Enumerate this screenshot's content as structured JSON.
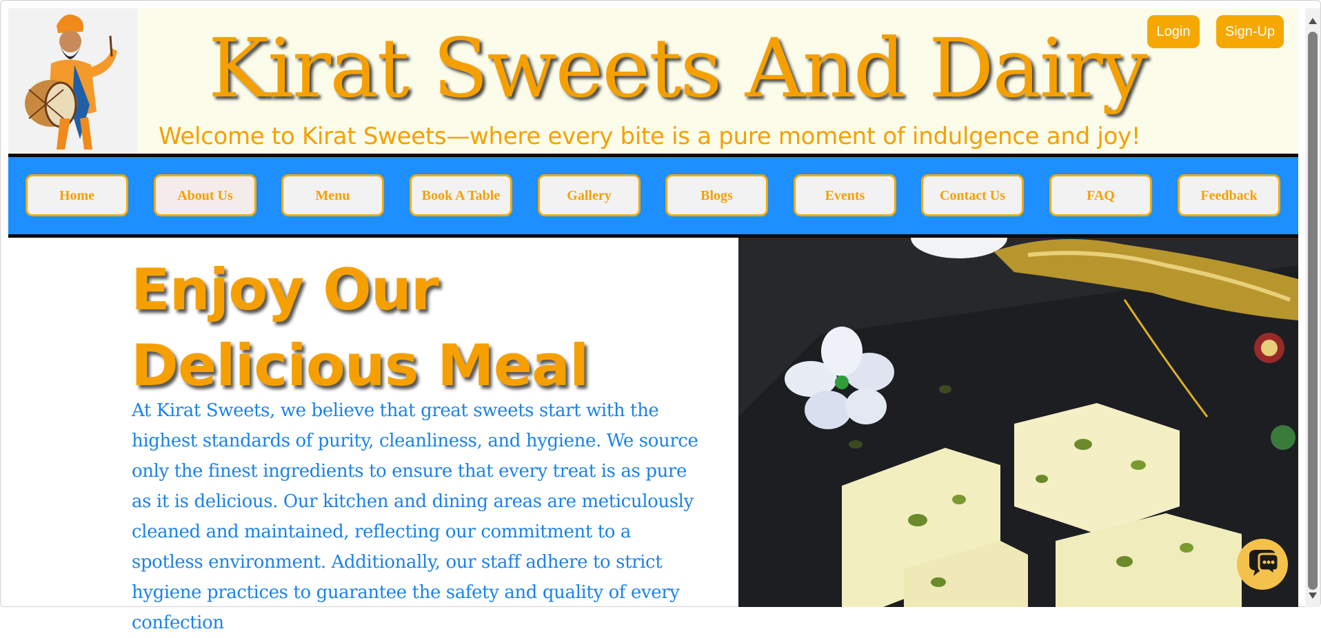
{
  "header": {
    "title": "Kirat Sweets And Dairy",
    "tagline": "Welcome to Kirat Sweets—where every bite is a pure moment of indulgence and joy!",
    "login_label": "Login",
    "signup_label": "Sign-Up",
    "logo_icon": "dhol-player-logo"
  },
  "nav": {
    "items": [
      {
        "label": "Home"
      },
      {
        "label": "About Us"
      },
      {
        "label": "Menu"
      },
      {
        "label": "Book A Table"
      },
      {
        "label": "Gallery"
      },
      {
        "label": "Blogs"
      },
      {
        "label": "Events"
      },
      {
        "label": "Contact Us"
      },
      {
        "label": "FAQ"
      },
      {
        "label": "Feedback"
      }
    ]
  },
  "hero": {
    "heading_line1": "Enjoy Our",
    "heading_line2": "Delicious Meal",
    "paragraph": "At Kirat Sweets, we believe that great sweets start with the highest standards of purity, cleanliness, and hygiene. We source only the finest ingredients to ensure that every treat is as pure as it is delicious. Our kitchen and dining areas are meticulously cleaned and maintained, reflecting our commitment to a spotless environment. Additionally, our staff adhere to strict hygiene practices to guarantee the safety and quality of every confection"
  },
  "chat": {
    "icon": "chat-bubble-icon"
  },
  "colors": {
    "brand_orange": "#f5a000",
    "nav_blue": "#1e8fff",
    "text_blue": "#1a82e8",
    "header_bg": "#fbfcea"
  }
}
